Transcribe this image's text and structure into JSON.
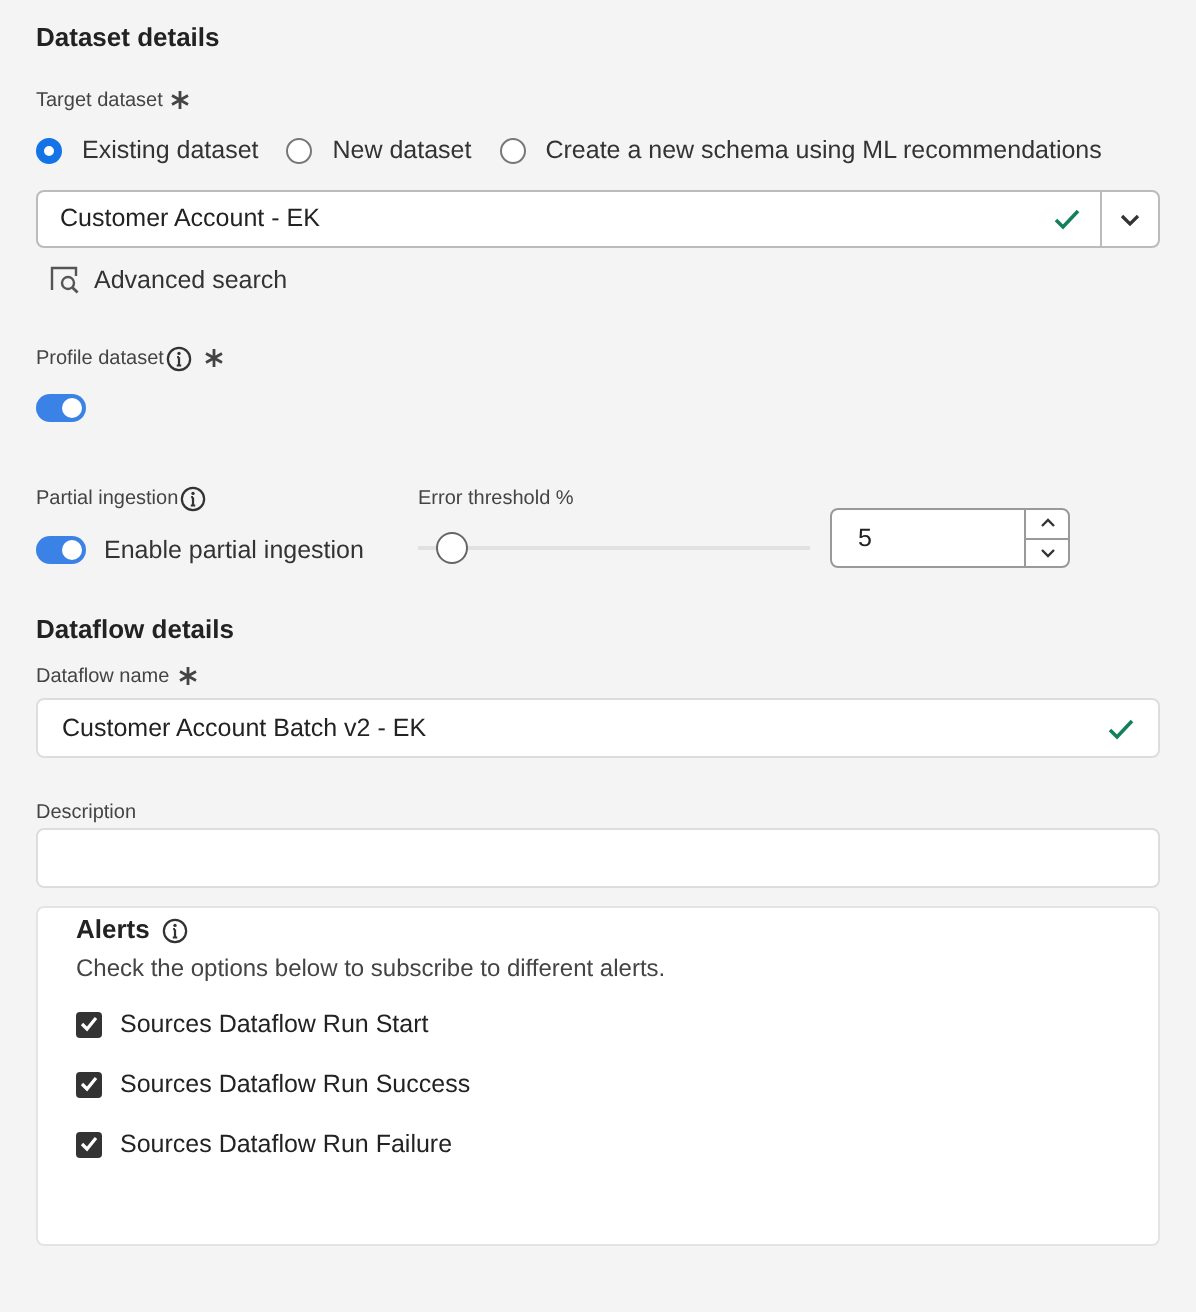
{
  "dataset_details": {
    "title": "Dataset details",
    "target_dataset": {
      "label": "Target dataset",
      "required": true,
      "options": [
        {
          "label": "Existing dataset",
          "selected": true
        },
        {
          "label": "New dataset",
          "selected": false
        },
        {
          "label": "Create a new schema using ML recommendations",
          "selected": false
        }
      ]
    },
    "dataset_select": {
      "value": "Customer Account - EK",
      "valid": true
    },
    "advanced_search": "Advanced search",
    "profile_dataset": {
      "label": "Profile dataset",
      "required": true,
      "on": true
    },
    "partial_ingestion": {
      "label": "Partial ingestion",
      "on": true,
      "toggle_label": "Enable partial ingestion"
    },
    "error_threshold": {
      "label": "Error threshold %",
      "level": 0.05,
      "value": "5"
    }
  },
  "dataflow_details": {
    "title": "Dataflow details",
    "dataflow_name": {
      "label": "Dataflow name",
      "required": true,
      "value": "Customer Account Batch v2 - EK",
      "valid": true
    },
    "description": {
      "label": "Description"
    },
    "alerts": {
      "title": "Alerts",
      "text": "Check the options below to subscribe to different alerts.",
      "options": [
        {
          "label": "Sources Dataflow Run Start",
          "checked": true
        },
        {
          "label": "Sources Dataflow Run Success",
          "checked": true
        },
        {
          "label": "Sources Dataflow Run Failure",
          "checked": true
        }
      ]
    }
  }
}
